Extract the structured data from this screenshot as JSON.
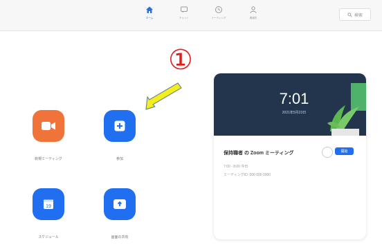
{
  "topbar": {
    "tabs": [
      {
        "label": "ホーム",
        "icon": "home-icon",
        "active": true
      },
      {
        "label": "チャット",
        "icon": "chat-icon",
        "active": false
      },
      {
        "label": "ミーティング",
        "icon": "clock-icon",
        "active": false
      },
      {
        "label": "連絡先",
        "icon": "contacts-icon",
        "active": false
      }
    ],
    "search_label": "検索"
  },
  "actions": {
    "new_meeting": "新規ミーティング",
    "join": "参加",
    "schedule": "スケジュール",
    "share_screen": "画面の共有"
  },
  "annotation": {
    "number": "①",
    "arrow_color": "#f5ee1f",
    "number_color": "#e02020"
  },
  "card": {
    "time": "7:01",
    "date": "2021年5月23日",
    "meeting_title": "保持職者 の Zoom ミーティング",
    "start_label": "開始",
    "meta_line1": "7:00 - 8:00 今日",
    "meta_line2": "ミーティングID: 000 000 0000"
  },
  "colors": {
    "accent": "#1f6ff0",
    "orange": "#f0743a",
    "banner": "#22354d"
  }
}
